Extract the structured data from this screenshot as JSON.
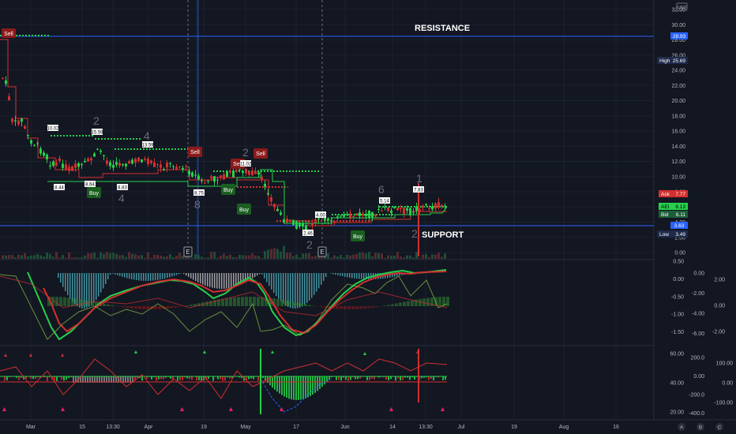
{
  "currency": "USD",
  "colors": {
    "background": "#131722",
    "bull": "#26d04a",
    "bear": "#d32f2f",
    "level_line": "#2962ff",
    "label_bg": "#1e2a4a",
    "ask": "#d32f2f",
    "bid": "#26d04a",
    "last": "#2962ff"
  },
  "main_pane": {
    "price_axis": [
      "32.00",
      "30.00",
      "28.00",
      "26.00",
      "24.00",
      "22.00",
      "20.00",
      "18.00",
      "16.00",
      "14.00",
      "12.00",
      "10.00",
      "8.00",
      "6.00",
      "4.00",
      "2.00",
      "0.00"
    ],
    "resistance": {
      "label": "RESISTANCE",
      "value": "28.93"
    },
    "support": {
      "label": "SUPPORT",
      "value": "3.63"
    },
    "high": {
      "label": "High",
      "value": "25.69"
    },
    "low": {
      "label": "Low",
      "value": "3.49"
    },
    "ask": {
      "label": "Ask",
      "value": "7.77"
    },
    "last": {
      "label": "AEI",
      "value": "6.13"
    },
    "bid": {
      "label": "Bid",
      "value": "6.11"
    },
    "signals": [
      {
        "text": "Sell",
        "kind": "sell"
      },
      {
        "text": "Buy",
        "kind": "buy"
      },
      {
        "text": "Sell",
        "kind": "sell"
      },
      {
        "text": "Buy",
        "kind": "buy"
      },
      {
        "text": "Buy",
        "kind": "buy"
      },
      {
        "text": "Sell",
        "kind": "sell"
      },
      {
        "text": "Sell",
        "kind": "sell"
      },
      {
        "text": "Buy",
        "kind": "buy"
      }
    ],
    "price_tags": [
      "10.02",
      "8.44",
      "15.59",
      "8.64",
      "13.59",
      "8.83",
      "8.75",
      "11.02",
      "4.00",
      "2.46",
      "5.14",
      "7.83"
    ],
    "wave_labels": [
      "2",
      "4",
      "4",
      "8",
      "2",
      "2",
      "6",
      "1",
      "2"
    ],
    "event_markers": [
      "E",
      "E"
    ]
  },
  "macd_pane": {
    "axis_left": [
      "0.50",
      "0.00",
      "-0.50",
      "-1.00",
      "-1.50"
    ],
    "axis_mid": [
      "0.00",
      "-2.00",
      "-4.00",
      "-6.00"
    ],
    "axis_right": [
      "2.00",
      "0.00",
      "-2.00"
    ]
  },
  "osc_pane": {
    "axis_left": [
      "60.00",
      "40.00",
      "20.00"
    ],
    "axis_mid": [
      "200.0",
      "0.00",
      "-200.0",
      "-400.0"
    ],
    "axis_right": [
      "100.00",
      "0.00",
      "-100.00"
    ]
  },
  "time_axis": [
    "Mar",
    "15",
    "13:30",
    "Apr",
    "19",
    "May",
    "17",
    "Jun",
    "14",
    "13:30",
    "Jul",
    "19",
    "Aug",
    "16"
  ],
  "bottom_buttons": [
    "A",
    "B",
    "C"
  ]
}
